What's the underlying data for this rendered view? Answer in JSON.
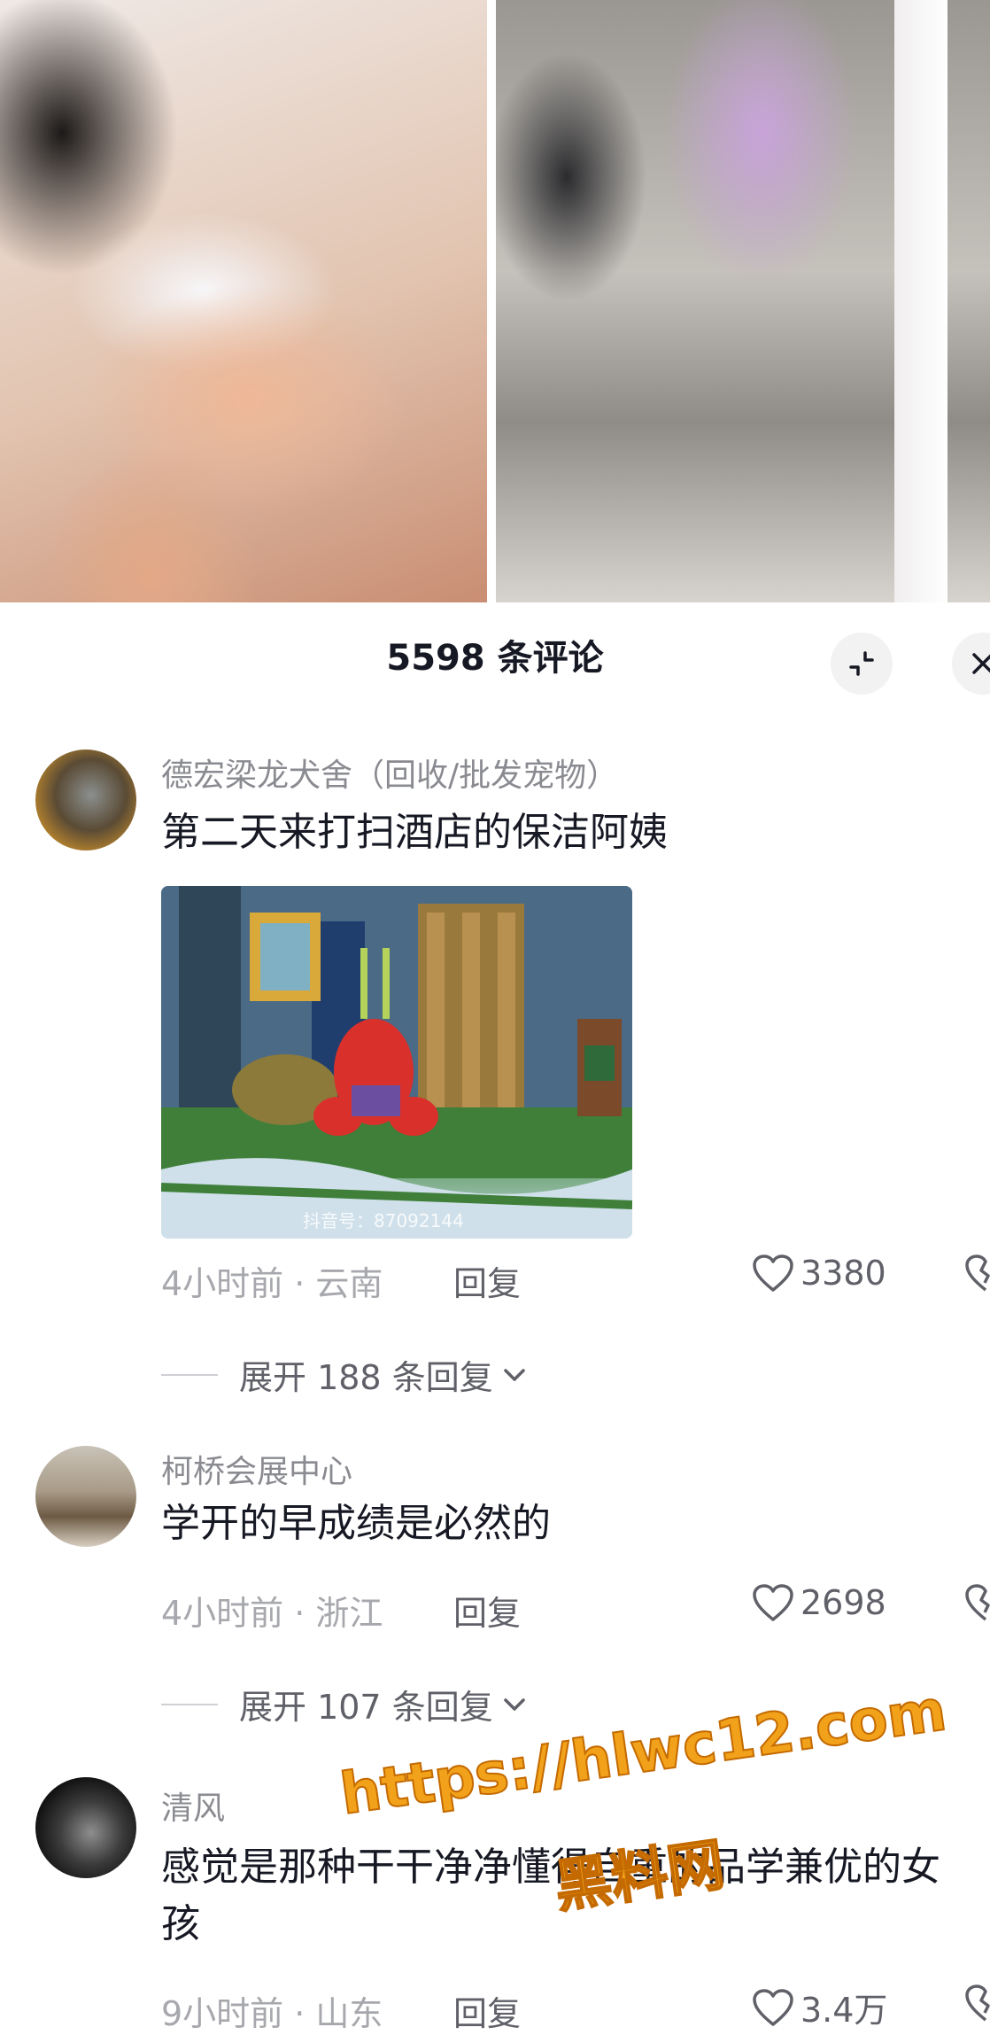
{
  "header": {
    "comment_count_title": "5598 条评论"
  },
  "comments": [
    {
      "username": "德宏梁龙犬舍（回收/批发宠物）",
      "text": "第二天来打扫酒店的保洁阿姨",
      "time_location": "4小时前 · 云南",
      "reply_label": "回复",
      "likes": "3380",
      "expand_label": "展开 188 条回复",
      "image_caption": "抖音号：87092144"
    },
    {
      "username": "柯桥会展中心",
      "text": "学开的早成绩是必然的",
      "time_location": "4小时前 · 浙江",
      "reply_label": "回复",
      "likes": "2698",
      "expand_label": "展开 107 条回复"
    },
    {
      "username": "清风",
      "text": "感觉是那种干干净净懂得自重的品学兼优的女孩",
      "time_location": "9小时前 · 山东",
      "reply_label": "回复",
      "likes": "3.4万"
    }
  ],
  "watermark": {
    "url": "https://hlwc12.com",
    "site_name": "黑料网"
  },
  "icons": {
    "collapse": "collapse-icon",
    "close": "close-icon",
    "like": "heart-icon",
    "dislike": "broken-heart-icon",
    "expand": "chevron-down-icon"
  },
  "colors": {
    "text_primary": "#161823",
    "text_secondary": "#8a8b91",
    "watermark": "#f2a21a"
  }
}
